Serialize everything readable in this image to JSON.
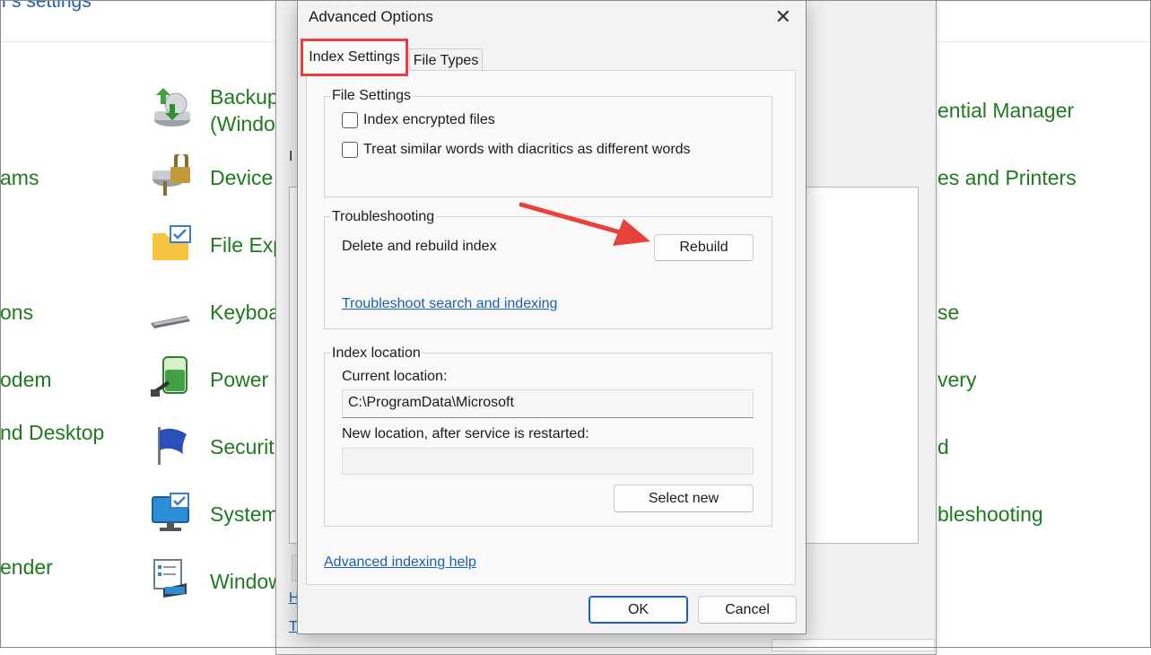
{
  "background": {
    "header_fragment": "r's settings",
    "left_links": [
      {
        "text": "ams"
      },
      {
        "text": "ons"
      },
      {
        "text": "odem"
      },
      {
        "text": "nd Desktop"
      },
      {
        "text": "ender"
      }
    ],
    "mid_links": [
      {
        "line1": "Backup",
        "line2": "(Windo",
        "icon": "backup-icon"
      },
      {
        "text": "Device",
        "icon": "device-lock-icon"
      },
      {
        "text": "File Exp",
        "icon": "file-explorer-icon"
      },
      {
        "text": "Keyboa",
        "icon": "keyboard-icon"
      },
      {
        "text": "Power C",
        "icon": "power-battery-icon"
      },
      {
        "text": "Securit",
        "icon": "security-flag-icon"
      },
      {
        "text": "System",
        "icon": "system-monitor-icon"
      },
      {
        "text": "Window",
        "icon": "windows-tools-icon"
      }
    ],
    "right_links": [
      {
        "text": "ential Manager"
      },
      {
        "text": "es and Printers"
      },
      {
        "text": "se"
      },
      {
        "text": "very"
      },
      {
        "text": "d"
      },
      {
        "text": "bleshooting"
      }
    ],
    "indexing_window_fragments": {
      "letter": "I",
      "link1": "H",
      "link2": "T"
    }
  },
  "dialog": {
    "title": "Advanced Options",
    "close_glyph": "✕",
    "tabs": [
      {
        "label": "Index Settings",
        "active": true
      },
      {
        "label": "File Types",
        "active": false
      }
    ],
    "file_settings": {
      "title": "File Settings",
      "options": [
        {
          "label": "Index encrypted files",
          "checked": false
        },
        {
          "label": "Treat similar words with diacritics as different words",
          "checked": false
        }
      ]
    },
    "troubleshooting": {
      "title": "Troubleshooting",
      "rebuild_label": "Delete and rebuild index",
      "rebuild_button": "Rebuild",
      "link": "Troubleshoot search and indexing"
    },
    "index_location": {
      "title": "Index location",
      "current_label": "Current location:",
      "current_value": "C:\\ProgramData\\Microsoft",
      "new_label": "New location, after service is restarted:",
      "new_value": "",
      "select_button": "Select new"
    },
    "help_link": "Advanced indexing help",
    "ok_button": "OK",
    "cancel_button": "Cancel"
  },
  "colors": {
    "link_green": "#1f7a1f",
    "link_blue": "#1a5fb4",
    "highlight_red": "#e8403a",
    "ok_border": "#1f5fb0"
  }
}
